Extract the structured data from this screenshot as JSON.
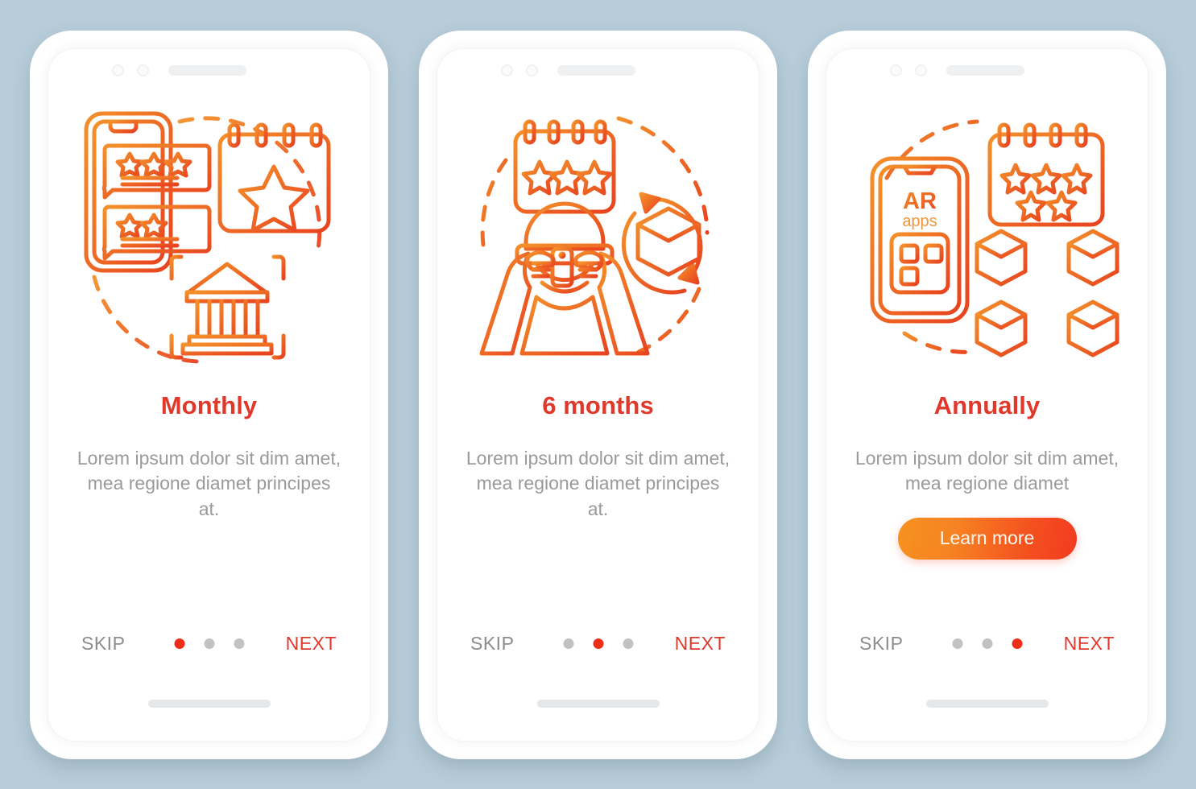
{
  "background_color": "#b7cdd9",
  "theme": {
    "title_color": "#e0392c",
    "body_color": "#9a9a9a",
    "skip_color": "#8c8c8c",
    "next_color": "#e0392c",
    "active_dot_color": "#ee2f18",
    "inactive_dot_color": "#c2c2c2",
    "cta_gradient_start": "#f69220",
    "cta_gradient_end": "#f23a21",
    "illustration_gradient_start": "#f4912a",
    "illustration_gradient_end": "#e8431f"
  },
  "screens": [
    {
      "id": "monthly",
      "title": "Monthly",
      "body": "Lorem ipsum dolor sit dim amet, mea regione diamet principes at.",
      "cta_label": "",
      "has_cta": false,
      "skip_label": "SKIP",
      "next_label": "NEXT",
      "dots_total": 3,
      "active_dot": 1,
      "illustration": {
        "name": "phone-reviews-calendar-bank",
        "elements": [
          "smartphone-outline",
          "review-bubble-three-stars",
          "review-bubble-two-stars",
          "calendar-with-star",
          "bank-building-in-scan-frame",
          "dashed-circle"
        ]
      }
    },
    {
      "id": "six-months",
      "title": "6 months",
      "body": "Lorem ipsum dolor sit dim amet, mea regione diamet principes at.",
      "cta_label": "",
      "has_cta": false,
      "skip_label": "SKIP",
      "next_label": "NEXT",
      "dots_total": 3,
      "active_dot": 2,
      "illustration": {
        "name": "calendar-ar-user-cube",
        "elements": [
          "calendar-with-three-stars",
          "person-holding-phone-ar",
          "rotating-3d-cube",
          "dashed-circle"
        ]
      }
    },
    {
      "id": "annually",
      "title": "Annually",
      "body": "Lorem ipsum dolor sit dim amet, mea regione diamet",
      "cta_label": "Learn more",
      "has_cta": true,
      "skip_label": "SKIP",
      "next_label": "NEXT",
      "dots_total": 3,
      "active_dot": 3,
      "illustration": {
        "name": "ar-apps-phone-calendar-blockchain",
        "phone_label_primary": "AR",
        "phone_label_secondary": "apps",
        "elements": [
          "smartphone-with-ar-apps",
          "calendar-with-five-stars",
          "connected-cubes-network",
          "dashed-circle"
        ]
      }
    }
  ]
}
